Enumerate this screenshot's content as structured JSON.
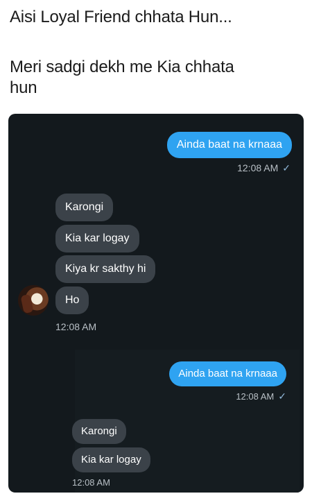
{
  "caption": {
    "line1": "Aisi Loyal Friend chhata Hun...",
    "line2": "Meri sadgi dekh me Kia chhata hun"
  },
  "chat1": {
    "outgoing": {
      "text": "Ainda baat na krnaaa",
      "time": "12:08 AM",
      "status_icon": "✓"
    },
    "incoming": [
      "Karongi",
      "Kia kar logay",
      "Kiya kr sakthy hi",
      "Ho"
    ],
    "incoming_time": "12:08 AM"
  },
  "chat2": {
    "outgoing": {
      "text": "Ainda baat na krnaaa",
      "time": "12:08 AM",
      "status_icon": "✓"
    },
    "incoming": [
      "Karongi",
      "Kia kar logay"
    ],
    "incoming_time": "12:08 AM"
  },
  "colors": {
    "chat_bg": "#13191d",
    "outgoing_bubble": "#2fa3f1",
    "incoming_bubble": "#3b4249"
  }
}
